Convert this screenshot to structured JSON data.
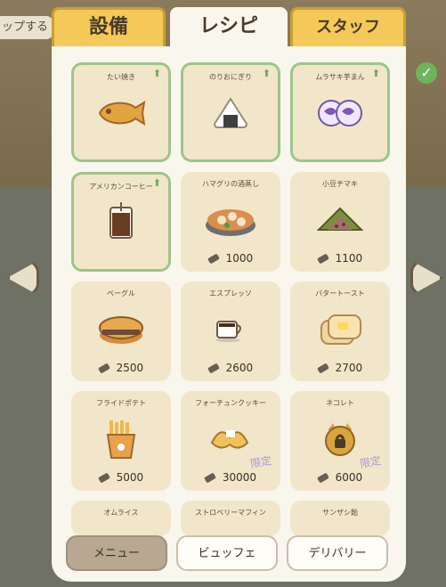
{
  "background": {
    "left_tag": "ップする",
    "check_icon": "check-icon"
  },
  "tabs": [
    {
      "label": "設備"
    },
    {
      "label": "レシピ"
    },
    {
      "label": "スタッフ"
    }
  ],
  "recipes": [
    {
      "name": "たい焼き",
      "price": "",
      "owned": true,
      "upgrade": true
    },
    {
      "name": "のりおにぎり",
      "price": "",
      "owned": true,
      "upgrade": true
    },
    {
      "name": "ムラサキ芋まん",
      "price": "",
      "owned": true,
      "upgrade": true
    },
    {
      "name": "アメリカンコーヒー",
      "price": "",
      "owned": true,
      "upgrade": true
    },
    {
      "name": "ハマグリの酒蒸し",
      "price": "1000",
      "owned": false
    },
    {
      "name": "小豆チマキ",
      "price": "1100",
      "owned": false
    },
    {
      "name": "ベーグル",
      "price": "2500",
      "owned": false
    },
    {
      "name": "エスプレッソ",
      "price": "2600",
      "owned": false
    },
    {
      "name": "バタートースト",
      "price": "2700",
      "owned": false
    },
    {
      "name": "フライドポテト",
      "price": "5000",
      "owned": false
    },
    {
      "name": "フォーチュンクッキー",
      "price": "30000",
      "owned": false,
      "limited": "限定"
    },
    {
      "name": "ネコレト",
      "price": "6000",
      "owned": false,
      "limited": "限定"
    },
    {
      "name": "オムライス",
      "price": "",
      "owned": false
    },
    {
      "name": "ストロベリーマフィン",
      "price": "",
      "owned": false
    },
    {
      "name": "サンザシ飴",
      "price": "",
      "owned": false
    }
  ],
  "bottom_buttons": [
    {
      "label": "メニュー"
    },
    {
      "label": "ビュッフェ"
    },
    {
      "label": "デリバリー"
    }
  ]
}
